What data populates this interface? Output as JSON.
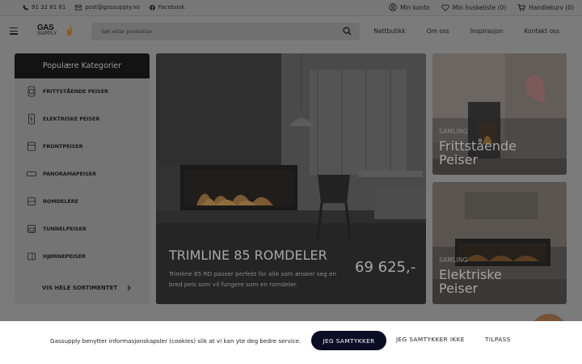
{
  "topbar": {
    "phone": "91 32 81 81",
    "email": "post@gassupply.no",
    "facebook": "Facebook",
    "account": "Min konto",
    "wishlist": "Min huskeliste (0)",
    "cart": "Handlekurv (0)"
  },
  "header": {
    "logo_top": "GAS",
    "logo_bottom": "SUPPLY",
    "search_placeholder": "Søk etter produkter",
    "nav": [
      "Nettbutikk",
      "Om oss",
      "Inspirasjon",
      "Kontakt oss"
    ]
  },
  "sidebar": {
    "title": "Populære Kategorier",
    "items": [
      {
        "label": "FRITTSTÅENDE PEISER",
        "icon": "freestanding-fireplace-icon"
      },
      {
        "label": "ELEKTRISKE PEISER",
        "icon": "electric-fireplace-icon"
      },
      {
        "label": "FRONTPEISER",
        "icon": "front-fireplace-icon"
      },
      {
        "label": "PANORAMAPEISER",
        "icon": "panorama-fireplace-icon"
      },
      {
        "label": "ROMDELERE",
        "icon": "room-divider-icon"
      },
      {
        "label": "TUNNELPEISER",
        "icon": "tunnel-fireplace-icon"
      },
      {
        "label": "HJØRNEPEISER",
        "icon": "corner-fireplace-icon"
      }
    ],
    "all_label": "VIS HELE SORTIMENTET"
  },
  "hero": {
    "title": "TRIMLINE 85 ROMDELER",
    "description": "Trimline 85 RD passer perfekt for alle som ønsker seg en bred peis som vil fungere som en romdeler.",
    "price": "69 625,-"
  },
  "cards": [
    {
      "tag": "SAMLING",
      "title": "Frittstående Peiser"
    },
    {
      "tag": "SAMLING",
      "title": "Elektriske Peiser"
    }
  ],
  "cookie": {
    "text": "Gassupply benytter informasjonskapsler (cookies) slik at vi kan yte deg bedre service.",
    "accept": "JEG SAMTYKKER",
    "decline": "JEG SAMTYKKER IKKE",
    "customize": "TILPASS"
  },
  "colors": {
    "accent_dark": "#0b0d26",
    "flame": "#e08a1a",
    "chat": "#b0804f"
  }
}
